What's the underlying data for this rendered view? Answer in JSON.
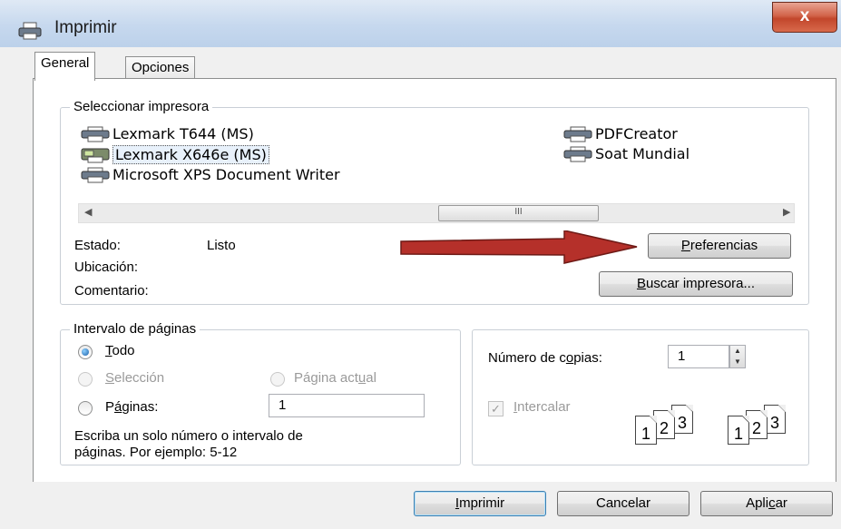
{
  "window": {
    "title": "Imprimir",
    "close_label": "x"
  },
  "tabs": [
    {
      "label": "General"
    },
    {
      "label": "Opciones"
    }
  ],
  "printer_group": {
    "legend": "Seleccionar impresora",
    "printers": [
      {
        "name": "Lexmark T644 (MS)"
      },
      {
        "name": "Lexmark X646e (MS)"
      },
      {
        "name": "Microsoft XPS Document Writer"
      },
      {
        "name": "PDFCreator"
      },
      {
        "name": "Soat Mundial"
      }
    ],
    "selected": "Lexmark X646e (MS)",
    "scroll_thumb": "III"
  },
  "status": {
    "estado_label": "Estado:",
    "estado_value": "Listo",
    "ubicacion_label": "Ubicación:",
    "comentario_label": "Comentario:"
  },
  "buttons": {
    "preferencias": {
      "ul": "P",
      "rest": "referencias"
    },
    "buscar": {
      "ul": "B",
      "rest": "uscar impresora..."
    },
    "imprimir": {
      "ul": "I",
      "rest": "mprimir"
    },
    "cancelar": "Cancelar",
    "aplicar": {
      "pre": "Apli",
      "ul": "c",
      "post": "ar"
    }
  },
  "range_group": {
    "legend": "Intervalo de páginas",
    "todo": {
      "ul": "T",
      "rest": "odo"
    },
    "seleccion": {
      "ul": "S",
      "rest": "elección"
    },
    "pagina_actual": {
      "pre": "Página act",
      "ul": "u",
      "post": "al"
    },
    "paginas": {
      "pre": "P",
      "ul": "á",
      "post": "ginas:"
    },
    "paginas_value": "1",
    "hint_line1": "Escriba un solo número o intervalo de",
    "hint_line2": "páginas. Por ejemplo: 5-12",
    "selected": "todo"
  },
  "copies_group": {
    "label": {
      "pre": "Número de c",
      "ul": "o",
      "post": "pias:"
    },
    "value": "1",
    "intercalar": {
      "ul": "I",
      "rest": "ntercalar"
    },
    "intercalar_checked": true,
    "stack_a": [
      "1",
      "2",
      "3"
    ],
    "stack_b": [
      "1",
      "2",
      "3"
    ]
  },
  "colors": {
    "arrow": "#b5302a",
    "titlebar": "#c6d8ee",
    "close": "#c2462b"
  }
}
